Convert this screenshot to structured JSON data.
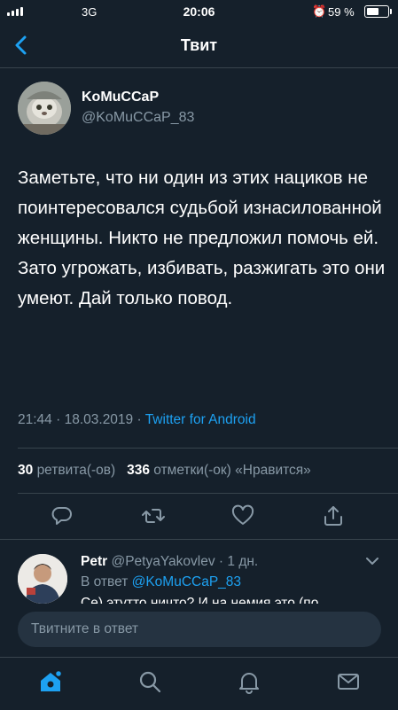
{
  "status_bar": {
    "network": "3G",
    "time": "20:06",
    "battery_percent": "59 %",
    "battery_level": 0.59,
    "alarm_icon": "alarm-icon"
  },
  "nav": {
    "title": "Твит",
    "back_icon": "chevron-left-icon"
  },
  "tweet": {
    "author_name": "KoMuCCaP",
    "author_handle": "@KoMuCCaP_83",
    "text": "Заметьте, что ни один из этих нациков не поинтересовался судьбой изнасилованной женщины. Никто не предложил помочь ей. Зато угрожать, избивать, разжигать это они умеют. Дай только повод.",
    "time": "21:44",
    "date": "18.03.2019",
    "separator": "·",
    "client": "Twitter for Android",
    "retweets_count": "30",
    "retweets_label": "ретвита(-ов)",
    "likes_count": "336",
    "likes_label": "отметки(-ок) «Нравится»"
  },
  "actions": [
    {
      "icon": "reply-icon"
    },
    {
      "icon": "retweet-icon"
    },
    {
      "icon": "like-icon"
    },
    {
      "icon": "share-icon"
    }
  ],
  "reply": {
    "name": "Petr",
    "handle": "@PetyaYakovlev",
    "separator": "·",
    "age": "1 дн.",
    "in_reply_prefix": "В ответ",
    "in_reply_mention": "@KoMuCCaP_83",
    "text_partial": "Се) этутто ничто? И на немия это (по"
  },
  "compose": {
    "placeholder": "Твитните в ответ"
  },
  "tab_bar": [
    {
      "icon": "home-icon",
      "active": true
    },
    {
      "icon": "search-icon",
      "active": false
    },
    {
      "icon": "notifications-icon",
      "active": false
    },
    {
      "icon": "messages-icon",
      "active": false
    }
  ],
  "colors": {
    "background": "#15202b",
    "accent": "#1da1f2",
    "secondary_text": "#8899a6",
    "divider": "#38444d"
  }
}
